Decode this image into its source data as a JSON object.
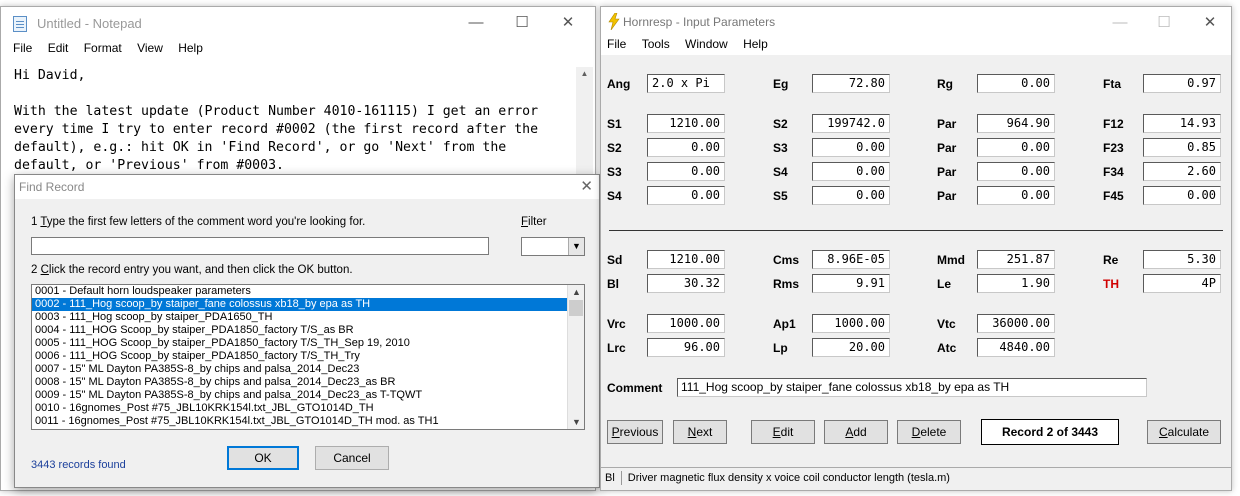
{
  "notepad": {
    "title": "Untitled - Notepad",
    "menu": [
      "File",
      "Edit",
      "Format",
      "View",
      "Help"
    ],
    "text": "Hi David,\n\nWith the latest update (Product Number 4010-161115) I get an error\nevery time I try to enter record #0002 (the first record after the\ndefault), e.g.: hit OK in 'Find Record', or go 'Next' from the\ndefault, or 'Previous' from #0003."
  },
  "find_record": {
    "title": "Find Record",
    "step1_prefix": "1  ",
    "step1_accel": "T",
    "step1_rest": "ype the first few letters of the comment word you're looking for.",
    "filter_accel": "F",
    "filter_rest": "ilter",
    "step2_prefix": "2  ",
    "step2_accel": "C",
    "step2_rest": "lick the record entry you want, and then click the OK button.",
    "search_value": "",
    "filter_value": "",
    "records": [
      "0001 - Default horn loudspeaker parameters",
      "0002 - 111_Hog scoop_by staiper_fane colossus xb18_by epa as TH",
      "0003 - 111_Hog scoop_by staiper_PDA1650_TH",
      "0004 - 111_HOG Scoop_by staiper_PDA1850_factory T/S_as BR",
      "0005 - 111_HOG Scoop_by staiper_PDA1850_factory T/S_TH_Sep 19, 2010",
      "0006 - 111_HOG Scoop_by staiper_PDA1850_factory T/S_TH_Try",
      "0007 - 15\" ML Dayton PA385S-8_by chips and palsa_2014_Dec23",
      "0008 - 15\" ML Dayton PA385S-8_by chips and palsa_2014_Dec23_as BR",
      "0009 - 15\" ML Dayton PA385S-8_by chips and palsa_2014_Dec23_as T-TQWT",
      "0010 - 16gnomes_Post #75_JBL10KRK154l.txt_JBL_GTO1014D_TH",
      "0011 - 16gnomes_Post #75_JBL10KRK154l.txt_JBL_GTO1014D_TH mod. as TH1"
    ],
    "selected_index": 1,
    "ok_label": "OK",
    "cancel_label": "Cancel",
    "records_found": "3443 records found"
  },
  "hornresp": {
    "title": "Hornresp - Input Parameters",
    "menu": [
      "File",
      "Tools",
      "Window",
      "Help"
    ],
    "params": {
      "Ang": "2.0 x Pi",
      "Eg": "72.80",
      "Rg": "0.00",
      "Fta": "0.97",
      "S1": "1210.00",
      "S2": "199742.0",
      "Par1": "964.90",
      "F12": "14.93",
      "S2b": "0.00",
      "S3": "0.00",
      "Par2": "0.00",
      "F23": "0.85",
      "S3b": "0.00",
      "S4": "0.00",
      "Par3": "0.00",
      "F34": "2.60",
      "S4b": "0.00",
      "S5": "0.00",
      "Par4": "0.00",
      "F45": "0.00",
      "Sd": "1210.00",
      "Cms": "8.96E-05",
      "Mmd": "251.87",
      "Re": "5.30",
      "Bl": "30.32",
      "Rms": "9.91",
      "Le": "1.90",
      "TH": "4P",
      "Vrc": "1000.00",
      "Ap1": "1000.00",
      "Vtc": "36000.00",
      "Lrc": "96.00",
      "Lp": "20.00",
      "Atc": "4840.00"
    },
    "labels": {
      "Ang": "Ang",
      "Eg": "Eg",
      "Rg": "Rg",
      "Fta": "Fta",
      "S1": "S1",
      "S2": "S2",
      "Par": "Par",
      "F12": "F12",
      "S3": "S3",
      "F23": "F23",
      "S4": "S4",
      "F34": "F34",
      "S5": "S5",
      "F45": "F45",
      "Sd": "Sd",
      "Cms": "Cms",
      "Mmd": "Mmd",
      "Re": "Re",
      "Bl": "Bl",
      "Rms": "Rms",
      "Le": "Le",
      "TH": "TH",
      "Vrc": "Vrc",
      "Ap1": "Ap1",
      "Vtc": "Vtc",
      "Lrc": "Lrc",
      "Lp": "Lp",
      "Atc": "Atc",
      "Comment": "Comment"
    },
    "comment": "111_Hog scoop_by staiper_fane colossus xb18_by epa as TH",
    "buttons": {
      "previous_accel": "P",
      "previous_rest": "revious",
      "next_accel": "N",
      "next_rest": "ext",
      "edit_accel": "E",
      "edit_rest": "dit",
      "add_accel": "A",
      "add_rest": "dd",
      "delete_accel": "D",
      "delete_rest": "elete",
      "calculate_accel": "C",
      "calculate_rest": "alculate"
    },
    "record_status": "Record 2 of 3443",
    "status_key": "Bl",
    "status_text": "Driver magnetic flux density x voice coil conductor length  (tesla.m)"
  }
}
